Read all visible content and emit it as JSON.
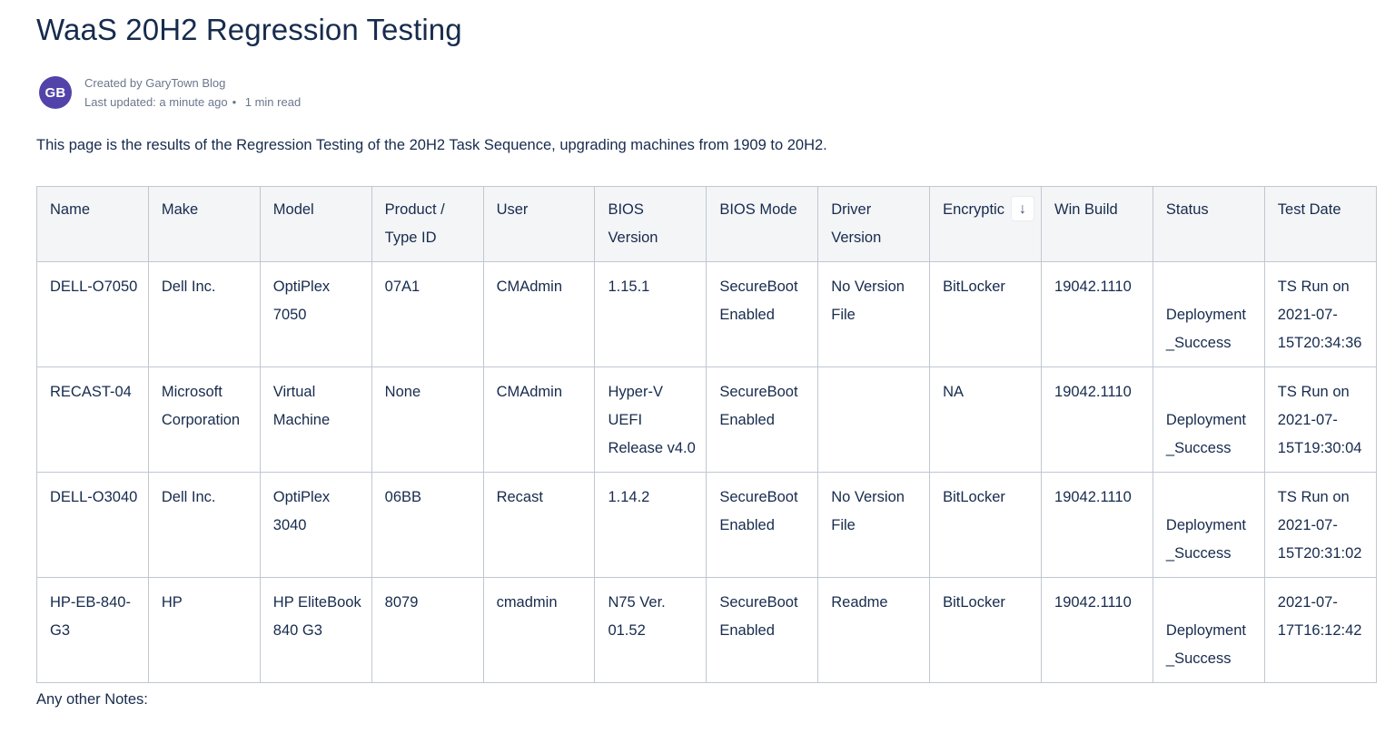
{
  "page": {
    "title": "WaaS 20H2 Regression Testing",
    "byline": {
      "avatar_initials": "GB",
      "avatar_color": "#5243aa",
      "created_by": "Created by GaryTown Blog",
      "last_updated": "Last updated: a minute ago",
      "separator": "•",
      "read_time": "1 min read"
    },
    "intro": "This page is the results of the Regression Testing of the 20H2 Task Sequence, upgrading machines from 1909 to 20H2.",
    "notes_label": "Any other Notes:"
  },
  "table": {
    "sorted_column": "Encryption",
    "sort_icon": "arrow-down-icon",
    "headers": [
      "Name",
      "Make",
      "Model",
      "Product / Type ID",
      "User",
      "BIOS Version",
      "BIOS Mode",
      "Driver Version",
      "Encryptic",
      "Win Build",
      "Status",
      "Test Date"
    ],
    "rows": [
      {
        "name": "DELL-O7050",
        "make": "Dell Inc.",
        "model": "OptiPlex 7050",
        "product_type_id": "07A1",
        "user": "CMAdmin",
        "bios_version": "1.15.1",
        "bios_mode": "SecureBoot Enabled",
        "driver_version": "No Version File",
        "encryption": "BitLocker",
        "win_build": "19042.1110",
        "status": "Deployment _Success",
        "test_date": "TS Run on 2021-07-15T20:34:36"
      },
      {
        "name": "RECAST-04",
        "make": "Microsoft Corporation",
        "model": "Virtual Machine",
        "product_type_id": "None",
        "user": "CMAdmin",
        "bios_version": "Hyper-V UEFI Release v4.0",
        "bios_mode": "SecureBoot Enabled",
        "driver_version": "",
        "encryption": "NA",
        "win_build": "19042.1110",
        "status": "Deployment _Success",
        "test_date": "TS Run on 2021-07-15T19:30:04"
      },
      {
        "name": "DELL-O3040",
        "make": "Dell Inc.",
        "model": "OptiPlex 3040",
        "product_type_id": "06BB",
        "user": "Recast",
        "bios_version": "1.14.2",
        "bios_mode": "SecureBoot Enabled",
        "driver_version": "No Version File",
        "encryption": "BitLocker",
        "win_build": "19042.1110",
        "status": "Deployment _Success",
        "test_date": "TS Run on 2021-07-15T20:31:02"
      },
      {
        "name": "HP-EB-840-G3",
        "make": "HP",
        "model": "HP EliteBook 840 G3",
        "product_type_id": "8079",
        "user": "cmadmin",
        "bios_version": "N75 Ver. 01.52",
        "bios_mode": "SecureBoot Enabled",
        "driver_version": "Readme",
        "encryption": "BitLocker",
        "win_build": "19042.1110",
        "status": "Deployment _Success",
        "test_date": "2021-07-17T16:12:42"
      }
    ]
  }
}
